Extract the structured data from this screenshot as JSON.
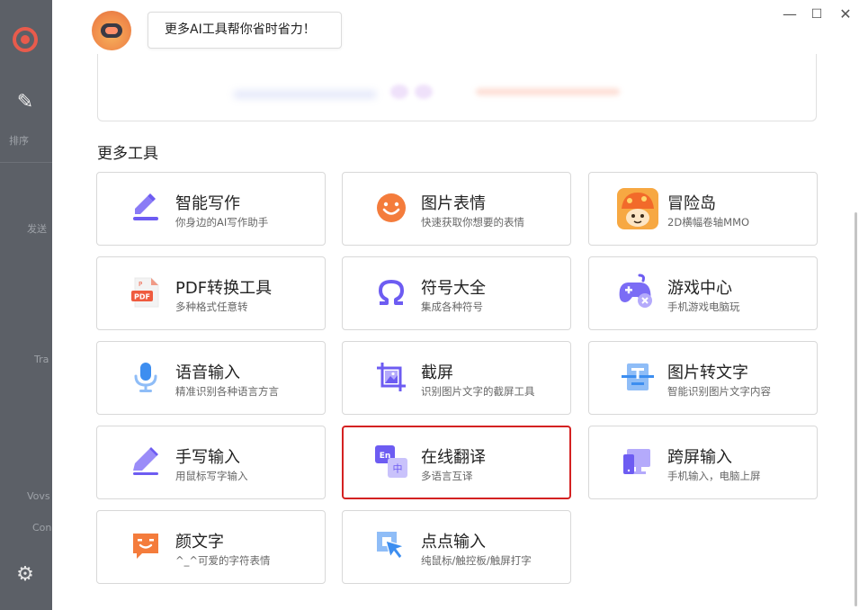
{
  "window": {
    "minimize": "—",
    "maximize": "☐",
    "close": "✕"
  },
  "header": {
    "bubble_text": "更多AI工具帮你省时省力！"
  },
  "section": {
    "title": "更多工具"
  },
  "tools": [
    {
      "title": "智能写作",
      "subtitle": "你身边的AI写作助手",
      "icon": "pen-write-icon"
    },
    {
      "title": "图片表情",
      "subtitle": "快速获取你想要的表情",
      "icon": "smiley-face-icon"
    },
    {
      "title": "冒险岛",
      "subtitle": "2D横幅卷轴MMO",
      "icon": "maplestory-mushroom-icon"
    },
    {
      "title": "PDF转换工具",
      "subtitle": "多种格式任意转",
      "icon": "pdf-file-icon"
    },
    {
      "title": "符号大全",
      "subtitle": "集成各种符号",
      "icon": "omega-symbol-icon"
    },
    {
      "title": "游戏中心",
      "subtitle": "手机游戏电脑玩",
      "icon": "gamepad-icon"
    },
    {
      "title": "语音输入",
      "subtitle": "精准识别各种语言方言",
      "icon": "microphone-icon"
    },
    {
      "title": "截屏",
      "subtitle": "识别图片文字的截屏工具",
      "icon": "screenshot-icon"
    },
    {
      "title": "图片转文字",
      "subtitle": "智能识别图片文字内容",
      "icon": "image-to-text-icon"
    },
    {
      "title": "手写输入",
      "subtitle": "用鼠标写字输入",
      "icon": "handwriting-pen-icon"
    },
    {
      "title": "在线翻译",
      "subtitle": "多语言互译",
      "icon": "translate-icon"
    },
    {
      "title": "跨屏输入",
      "subtitle": "手机输入，电脑上屏",
      "icon": "cross-screen-icon"
    },
    {
      "title": "颜文字",
      "subtitle": "^_^可爱的字符表情",
      "icon": "kaomoji-icon"
    },
    {
      "title": "点点输入",
      "subtitle": "纯鼠标/触控板/触屏打字",
      "icon": "click-input-icon"
    }
  ],
  "background_app": {
    "sort_label": "排序",
    "item_a": "发送",
    "item_b": "Tra",
    "item_c": "Vovs",
    "item_d": "Con"
  }
}
